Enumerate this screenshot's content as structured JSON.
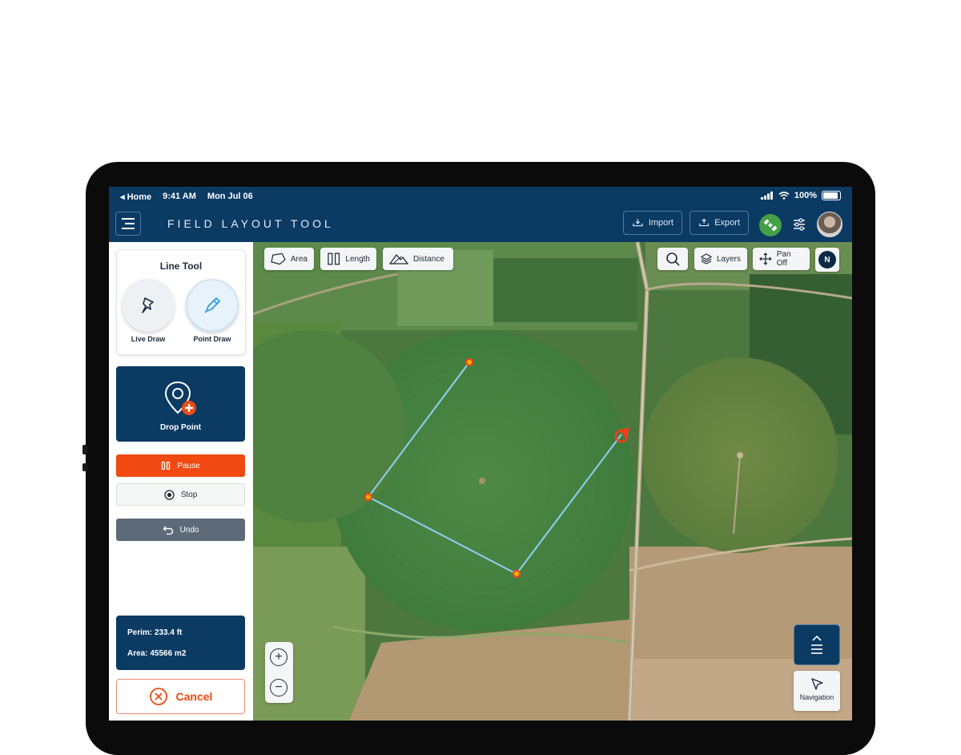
{
  "status_bar": {
    "back_label": "◂ Home",
    "time": "9:41 AM",
    "date": "Mon Jul 06",
    "battery": "100%"
  },
  "header": {
    "title": "FIELD LAYOUT TOOL",
    "import_label": "Import",
    "export_label": "Export"
  },
  "line_tool": {
    "title": "Line Tool",
    "live_draw_label": "Live Draw",
    "point_draw_label": "Point Draw"
  },
  "drop_point": {
    "label": "Drop Point"
  },
  "controls": {
    "pause_label": "Pause",
    "stop_label": "Stop",
    "undo_label": "Undo",
    "cancel_label": "Cancel"
  },
  "stats": {
    "perimeter": "Perim: 233.4 ft",
    "area": "Area: 45566 m2"
  },
  "map_toolbar": {
    "area_label": "Area",
    "length_label": "Length",
    "distance_label": "Distance",
    "layers_label": "Layers",
    "pan_label": "Pan Off",
    "compass_label": "N"
  },
  "map_controls": {
    "zoom_in": "+",
    "zoom_out": "−",
    "navigation_label": "Navigation"
  },
  "colors": {
    "navy": "#0b3a63",
    "accent_orange": "#f04a12",
    "line_blue": "#8fd0f2",
    "vertex_red": "#ff3b1a",
    "satellite_green": "#43a047"
  }
}
